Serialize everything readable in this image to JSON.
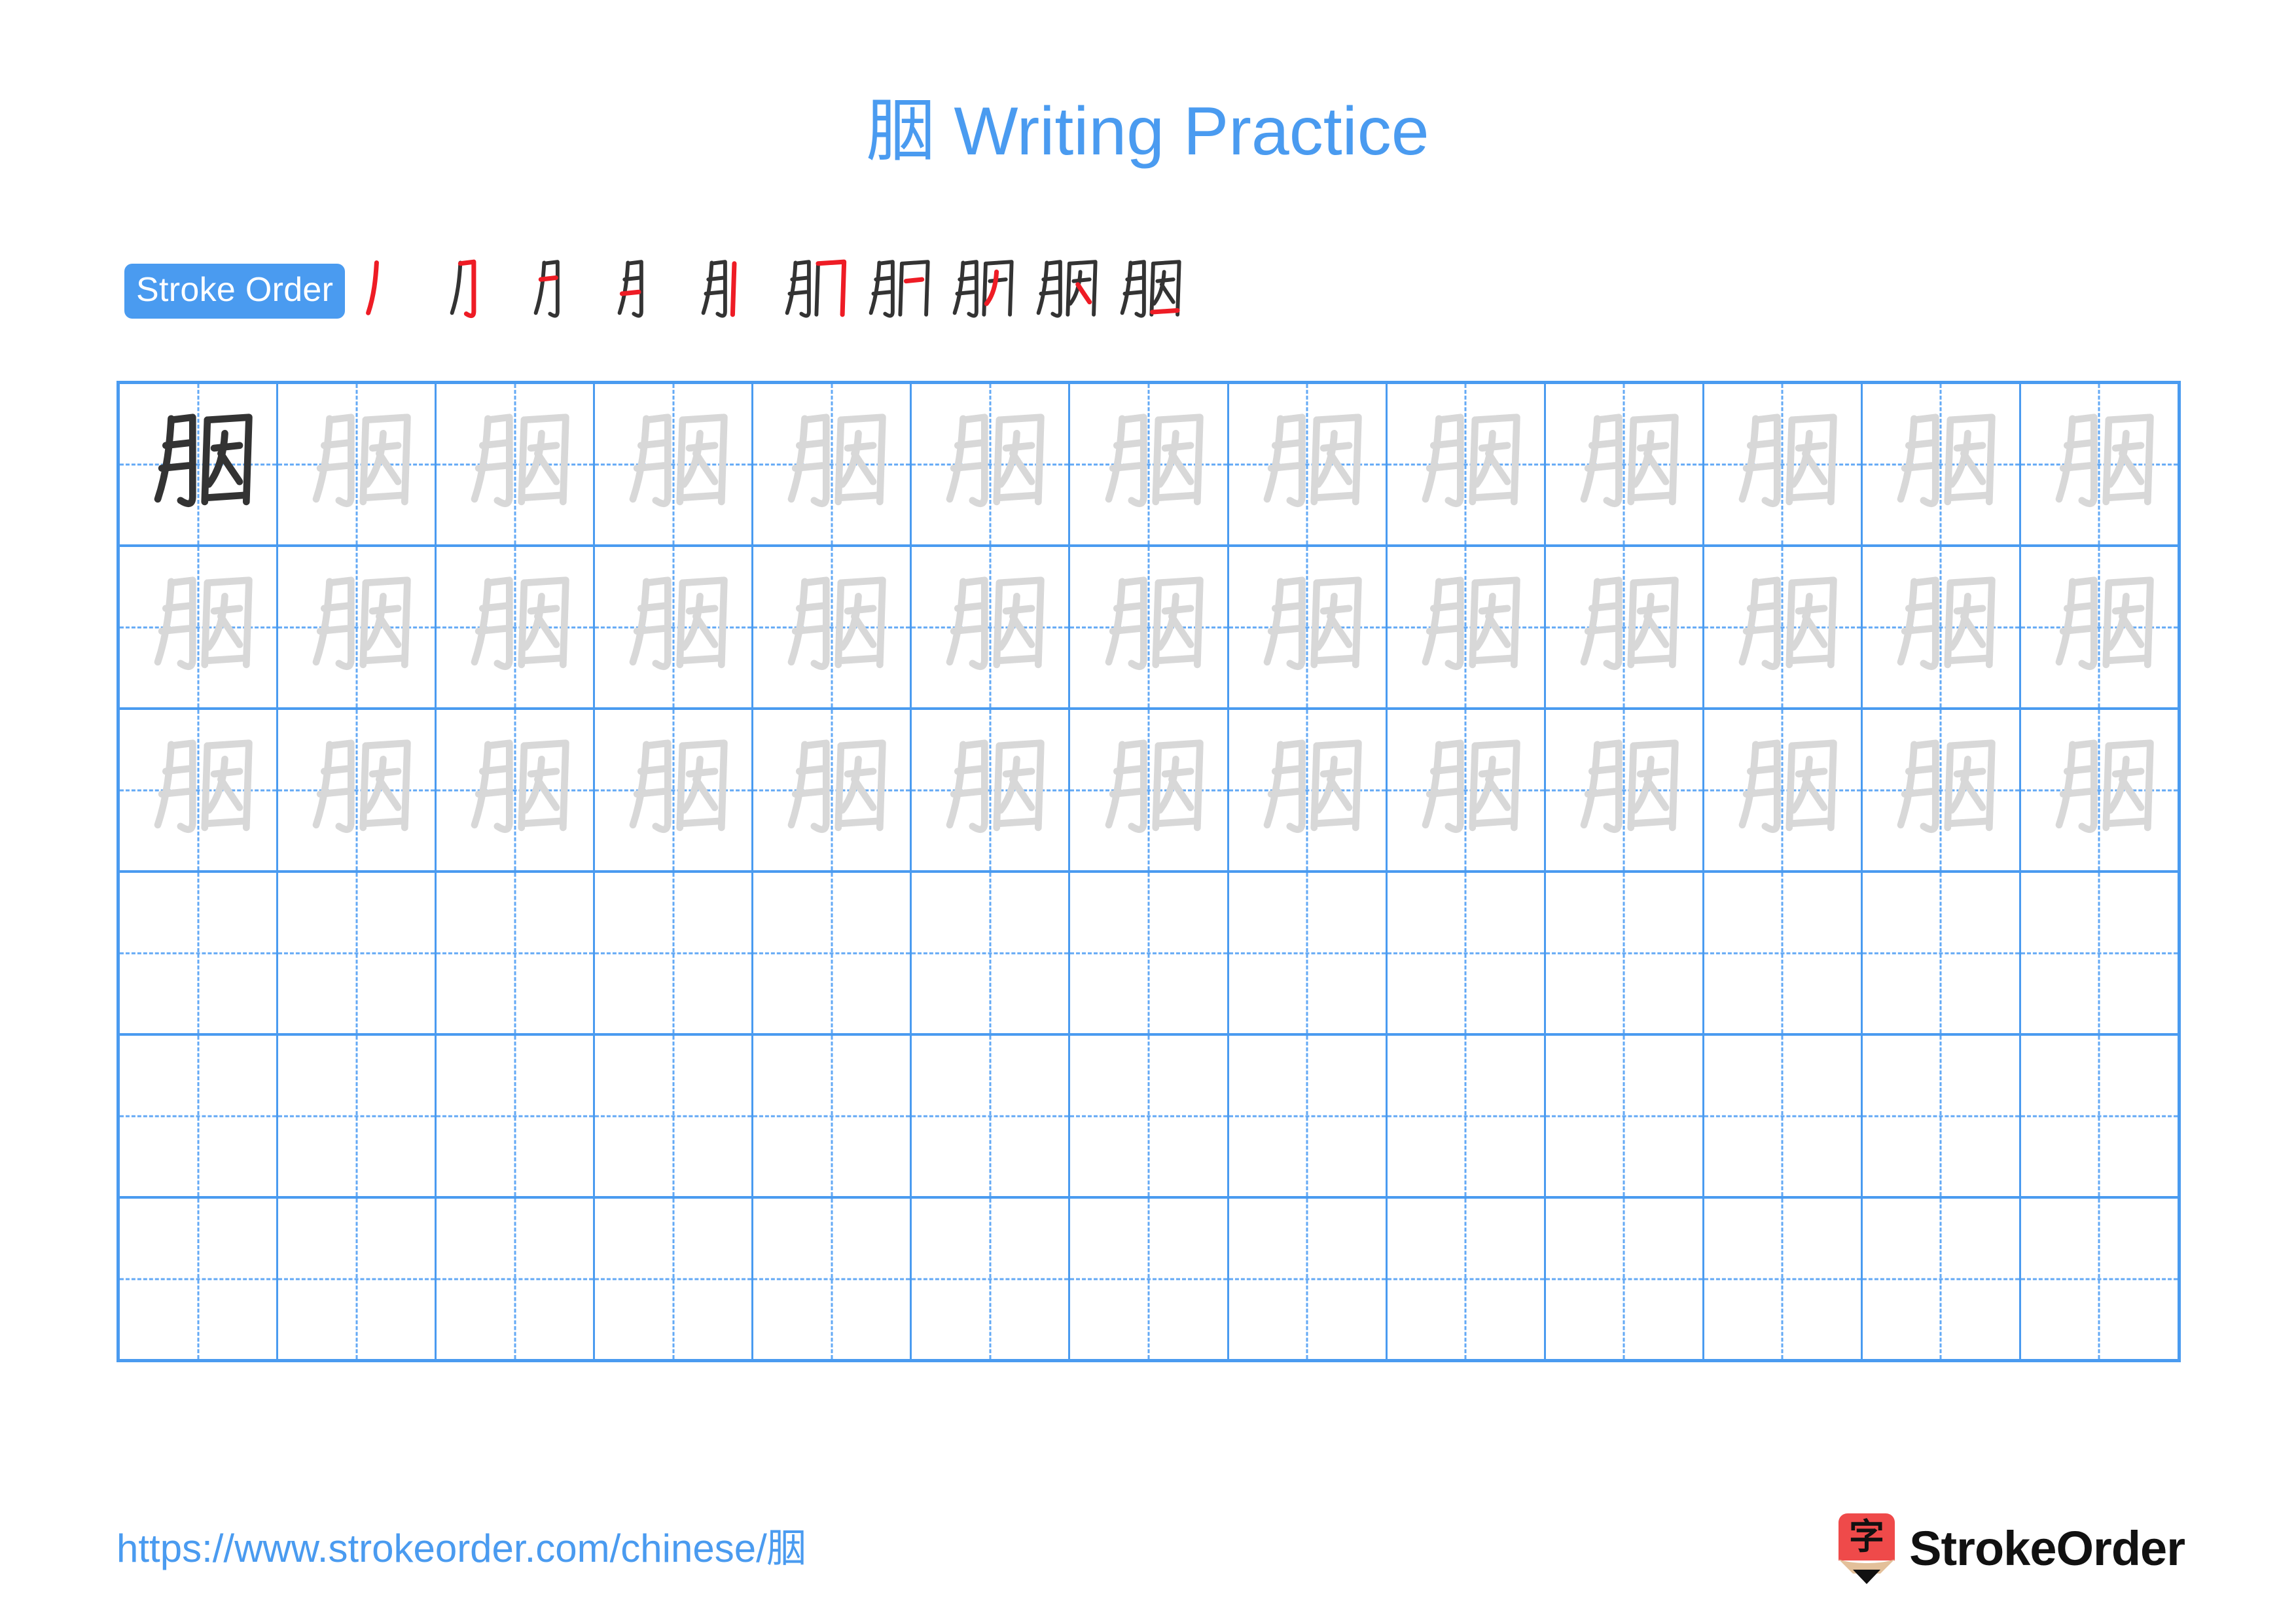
{
  "page": {
    "character": "胭",
    "title_suffix": "Writing Practice",
    "title_full": "胭 Writing Practice",
    "background_color": "#ffffff",
    "accent_color": "#4a9bf0",
    "stroke_new_color": "#ee1c25",
    "stroke_done_color": "#333333",
    "trace_color": "#d8d8d8"
  },
  "stroke_order": {
    "badge_label": "Stroke Order",
    "total_strokes": 10,
    "steps": [
      {
        "index": 1,
        "label": "stroke-1",
        "partial": "丿"
      },
      {
        "index": 2,
        "label": "stroke-2",
        "partial": "冂"
      },
      {
        "index": 3,
        "label": "stroke-3",
        "partial": "月"
      },
      {
        "index": 4,
        "label": "stroke-4",
        "partial": "月"
      },
      {
        "index": 5,
        "label": "stroke-5",
        "partial": "月"
      },
      {
        "index": 6,
        "label": "stroke-6",
        "partial": "肌"
      },
      {
        "index": 7,
        "label": "stroke-7",
        "partial": "肍"
      },
      {
        "index": 8,
        "label": "stroke-8",
        "partial": "朋"
      },
      {
        "index": 9,
        "label": "stroke-9",
        "partial": "胬"
      },
      {
        "index": 10,
        "label": "stroke-10",
        "partial": "胭"
      }
    ]
  },
  "grid": {
    "columns": 13,
    "rows": 6,
    "rows_data": [
      {
        "row": 1,
        "cells": [
          "solid",
          "trace",
          "trace",
          "trace",
          "trace",
          "trace",
          "trace",
          "trace",
          "trace",
          "trace",
          "trace",
          "trace",
          "trace"
        ]
      },
      {
        "row": 2,
        "cells": [
          "trace",
          "trace",
          "trace",
          "trace",
          "trace",
          "trace",
          "trace",
          "trace",
          "trace",
          "trace",
          "trace",
          "trace",
          "trace"
        ]
      },
      {
        "row": 3,
        "cells": [
          "trace",
          "trace",
          "trace",
          "trace",
          "trace",
          "trace",
          "trace",
          "trace",
          "trace",
          "trace",
          "trace",
          "trace",
          "trace"
        ]
      },
      {
        "row": 4,
        "cells": [
          "empty",
          "empty",
          "empty",
          "empty",
          "empty",
          "empty",
          "empty",
          "empty",
          "empty",
          "empty",
          "empty",
          "empty",
          "empty"
        ]
      },
      {
        "row": 5,
        "cells": [
          "empty",
          "empty",
          "empty",
          "empty",
          "empty",
          "empty",
          "empty",
          "empty",
          "empty",
          "empty",
          "empty",
          "empty",
          "empty"
        ]
      },
      {
        "row": 6,
        "cells": [
          "empty",
          "empty",
          "empty",
          "empty",
          "empty",
          "empty",
          "empty",
          "empty",
          "empty",
          "empty",
          "empty",
          "empty",
          "empty"
        ]
      }
    ]
  },
  "footer": {
    "url": "https://www.strokeorder.com/chinese/胭",
    "brand_name": "StrokeOrder",
    "brand_mark_char": "字",
    "brand_mark_color": "#ef4a4a",
    "brand_mark_wood_color": "#e3c09a"
  }
}
